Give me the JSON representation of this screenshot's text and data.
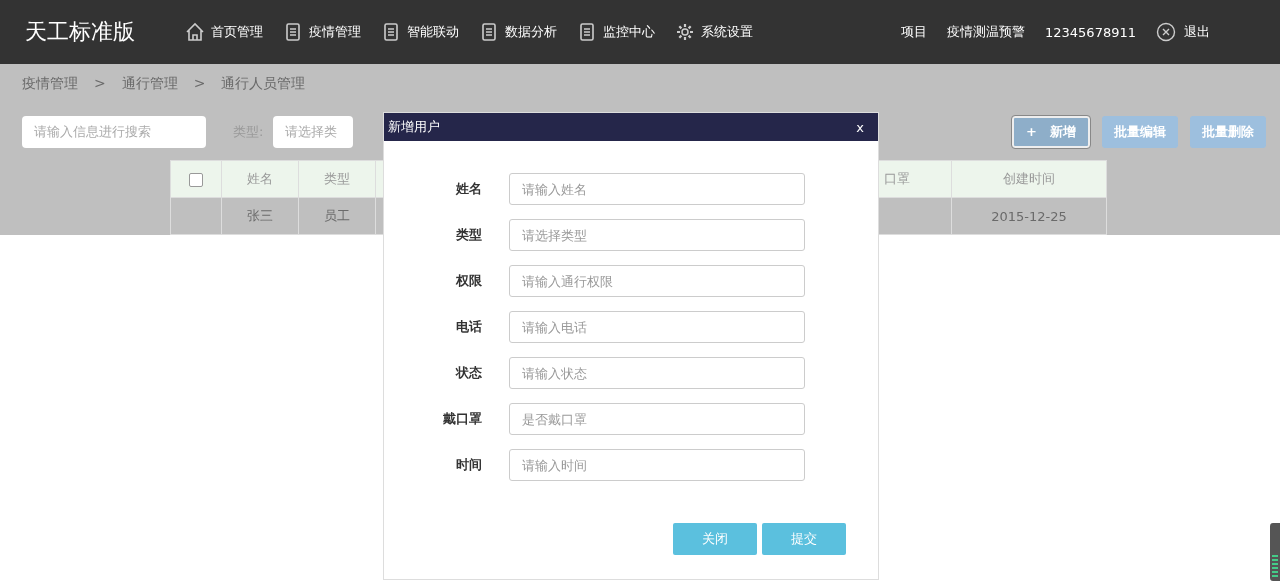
{
  "header": {
    "logo": "天工标准版",
    "nav": [
      {
        "label": "首页管理",
        "kind": "home"
      },
      {
        "label": "疫情管理",
        "kind": "page"
      },
      {
        "label": "智能联动",
        "kind": "page"
      },
      {
        "label": "数据分析",
        "kind": "page"
      },
      {
        "label": "监控中心",
        "kind": "page"
      },
      {
        "label": "系统设置",
        "kind": "settings"
      }
    ],
    "project": "项目",
    "alert": "疫情测温预警",
    "phone": "12345678911",
    "logout": "退出"
  },
  "breadcrumb": [
    "疫情管理",
    "通行管理",
    "通行人员管理"
  ],
  "breadcrumb_separator": ">",
  "search": {
    "placeholder": "请输入信息进行搜索"
  },
  "type_filter": {
    "label": "类型:",
    "placeholder": "请选择类"
  },
  "buttons": [
    {
      "label": "新增",
      "icon": "+",
      "focused": true
    },
    {
      "label": "批量编辑",
      "focused": false
    },
    {
      "label": "批量删除",
      "focused": false
    }
  ],
  "table": {
    "checked": false,
    "columns": [
      "姓名",
      "类型",
      "口罩",
      "创建时间"
    ],
    "rows": [
      [
        "张三",
        "员工",
        "",
        "2015-12-25"
      ]
    ]
  },
  "dialog": {
    "title": "新增用户",
    "close": "x",
    "fields": [
      {
        "label": "姓名",
        "placeholder": "请输入姓名"
      },
      {
        "label": "类型",
        "placeholder": "请选择类型"
      },
      {
        "label": "权限",
        "placeholder": "请输入通行权限"
      },
      {
        "label": "电话",
        "placeholder": "请输入电话"
      },
      {
        "label": "状态",
        "placeholder": "请输入状态"
      },
      {
        "label": "戴口罩",
        "placeholder": "是否戴口罩"
      },
      {
        "label": "时间",
        "placeholder": "请输入时间"
      }
    ],
    "buttons": [
      "关闭",
      "提交"
    ]
  }
}
